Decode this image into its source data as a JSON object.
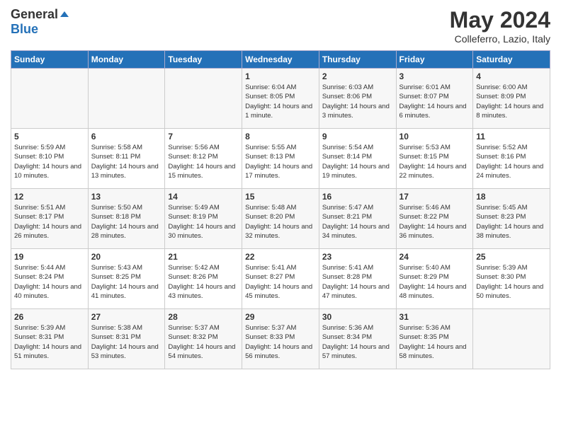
{
  "header": {
    "logo_general": "General",
    "logo_blue": "Blue",
    "title": "May 2024",
    "location": "Colleferro, Lazio, Italy"
  },
  "weekdays": [
    "Sunday",
    "Monday",
    "Tuesday",
    "Wednesday",
    "Thursday",
    "Friday",
    "Saturday"
  ],
  "weeks": [
    [
      {
        "day": "",
        "sunrise": "",
        "sunset": "",
        "daylight": ""
      },
      {
        "day": "",
        "sunrise": "",
        "sunset": "",
        "daylight": ""
      },
      {
        "day": "",
        "sunrise": "",
        "sunset": "",
        "daylight": ""
      },
      {
        "day": "1",
        "sunrise": "Sunrise: 6:04 AM",
        "sunset": "Sunset: 8:05 PM",
        "daylight": "Daylight: 14 hours and 1 minute."
      },
      {
        "day": "2",
        "sunrise": "Sunrise: 6:03 AM",
        "sunset": "Sunset: 8:06 PM",
        "daylight": "Daylight: 14 hours and 3 minutes."
      },
      {
        "day": "3",
        "sunrise": "Sunrise: 6:01 AM",
        "sunset": "Sunset: 8:07 PM",
        "daylight": "Daylight: 14 hours and 6 minutes."
      },
      {
        "day": "4",
        "sunrise": "Sunrise: 6:00 AM",
        "sunset": "Sunset: 8:09 PM",
        "daylight": "Daylight: 14 hours and 8 minutes."
      }
    ],
    [
      {
        "day": "5",
        "sunrise": "Sunrise: 5:59 AM",
        "sunset": "Sunset: 8:10 PM",
        "daylight": "Daylight: 14 hours and 10 minutes."
      },
      {
        "day": "6",
        "sunrise": "Sunrise: 5:58 AM",
        "sunset": "Sunset: 8:11 PM",
        "daylight": "Daylight: 14 hours and 13 minutes."
      },
      {
        "day": "7",
        "sunrise": "Sunrise: 5:56 AM",
        "sunset": "Sunset: 8:12 PM",
        "daylight": "Daylight: 14 hours and 15 minutes."
      },
      {
        "day": "8",
        "sunrise": "Sunrise: 5:55 AM",
        "sunset": "Sunset: 8:13 PM",
        "daylight": "Daylight: 14 hours and 17 minutes."
      },
      {
        "day": "9",
        "sunrise": "Sunrise: 5:54 AM",
        "sunset": "Sunset: 8:14 PM",
        "daylight": "Daylight: 14 hours and 19 minutes."
      },
      {
        "day": "10",
        "sunrise": "Sunrise: 5:53 AM",
        "sunset": "Sunset: 8:15 PM",
        "daylight": "Daylight: 14 hours and 22 minutes."
      },
      {
        "day": "11",
        "sunrise": "Sunrise: 5:52 AM",
        "sunset": "Sunset: 8:16 PM",
        "daylight": "Daylight: 14 hours and 24 minutes."
      }
    ],
    [
      {
        "day": "12",
        "sunrise": "Sunrise: 5:51 AM",
        "sunset": "Sunset: 8:17 PM",
        "daylight": "Daylight: 14 hours and 26 minutes."
      },
      {
        "day": "13",
        "sunrise": "Sunrise: 5:50 AM",
        "sunset": "Sunset: 8:18 PM",
        "daylight": "Daylight: 14 hours and 28 minutes."
      },
      {
        "day": "14",
        "sunrise": "Sunrise: 5:49 AM",
        "sunset": "Sunset: 8:19 PM",
        "daylight": "Daylight: 14 hours and 30 minutes."
      },
      {
        "day": "15",
        "sunrise": "Sunrise: 5:48 AM",
        "sunset": "Sunset: 8:20 PM",
        "daylight": "Daylight: 14 hours and 32 minutes."
      },
      {
        "day": "16",
        "sunrise": "Sunrise: 5:47 AM",
        "sunset": "Sunset: 8:21 PM",
        "daylight": "Daylight: 14 hours and 34 minutes."
      },
      {
        "day": "17",
        "sunrise": "Sunrise: 5:46 AM",
        "sunset": "Sunset: 8:22 PM",
        "daylight": "Daylight: 14 hours and 36 minutes."
      },
      {
        "day": "18",
        "sunrise": "Sunrise: 5:45 AM",
        "sunset": "Sunset: 8:23 PM",
        "daylight": "Daylight: 14 hours and 38 minutes."
      }
    ],
    [
      {
        "day": "19",
        "sunrise": "Sunrise: 5:44 AM",
        "sunset": "Sunset: 8:24 PM",
        "daylight": "Daylight: 14 hours and 40 minutes."
      },
      {
        "day": "20",
        "sunrise": "Sunrise: 5:43 AM",
        "sunset": "Sunset: 8:25 PM",
        "daylight": "Daylight: 14 hours and 41 minutes."
      },
      {
        "day": "21",
        "sunrise": "Sunrise: 5:42 AM",
        "sunset": "Sunset: 8:26 PM",
        "daylight": "Daylight: 14 hours and 43 minutes."
      },
      {
        "day": "22",
        "sunrise": "Sunrise: 5:41 AM",
        "sunset": "Sunset: 8:27 PM",
        "daylight": "Daylight: 14 hours and 45 minutes."
      },
      {
        "day": "23",
        "sunrise": "Sunrise: 5:41 AM",
        "sunset": "Sunset: 8:28 PM",
        "daylight": "Daylight: 14 hours and 47 minutes."
      },
      {
        "day": "24",
        "sunrise": "Sunrise: 5:40 AM",
        "sunset": "Sunset: 8:29 PM",
        "daylight": "Daylight: 14 hours and 48 minutes."
      },
      {
        "day": "25",
        "sunrise": "Sunrise: 5:39 AM",
        "sunset": "Sunset: 8:30 PM",
        "daylight": "Daylight: 14 hours and 50 minutes."
      }
    ],
    [
      {
        "day": "26",
        "sunrise": "Sunrise: 5:39 AM",
        "sunset": "Sunset: 8:31 PM",
        "daylight": "Daylight: 14 hours and 51 minutes."
      },
      {
        "day": "27",
        "sunrise": "Sunrise: 5:38 AM",
        "sunset": "Sunset: 8:31 PM",
        "daylight": "Daylight: 14 hours and 53 minutes."
      },
      {
        "day": "28",
        "sunrise": "Sunrise: 5:37 AM",
        "sunset": "Sunset: 8:32 PM",
        "daylight": "Daylight: 14 hours and 54 minutes."
      },
      {
        "day": "29",
        "sunrise": "Sunrise: 5:37 AM",
        "sunset": "Sunset: 8:33 PM",
        "daylight": "Daylight: 14 hours and 56 minutes."
      },
      {
        "day": "30",
        "sunrise": "Sunrise: 5:36 AM",
        "sunset": "Sunset: 8:34 PM",
        "daylight": "Daylight: 14 hours and 57 minutes."
      },
      {
        "day": "31",
        "sunrise": "Sunrise: 5:36 AM",
        "sunset": "Sunset: 8:35 PM",
        "daylight": "Daylight: 14 hours and 58 minutes."
      },
      {
        "day": "",
        "sunrise": "",
        "sunset": "",
        "daylight": ""
      }
    ]
  ]
}
